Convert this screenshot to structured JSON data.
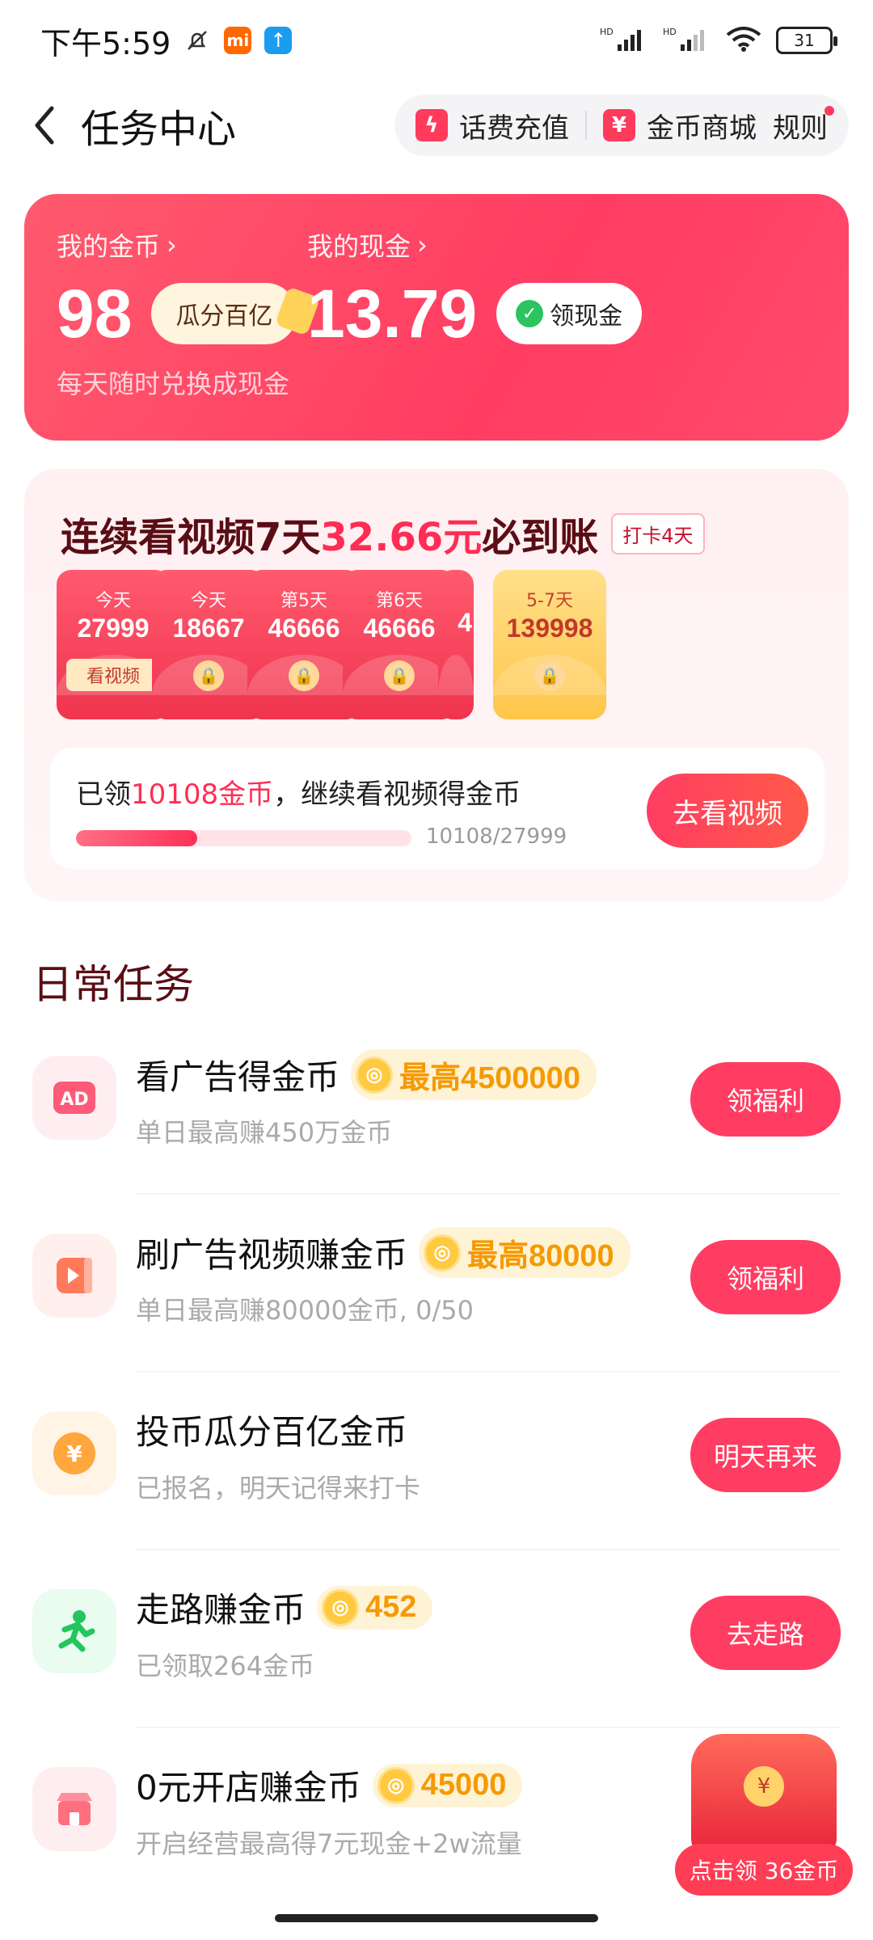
{
  "status_bar": {
    "time": "下午5:59",
    "battery": "31"
  },
  "header": {
    "title": "任务中心",
    "actions": {
      "recharge": "话费充值",
      "mall": "金币商城",
      "rules": "规则"
    }
  },
  "wallet": {
    "coins_label": "我的金币",
    "coins_value": "98",
    "share_btn": "瓜分百亿",
    "coins_sub": "每天随时兑换成现金",
    "cash_label": "我的现金",
    "cash_value": "13.79",
    "withdraw_btn": "领现金"
  },
  "streak": {
    "title_a": "连续看视频7天",
    "title_amount": "32.66元",
    "title_b": "必到账",
    "checkin_tag": "打卡4天",
    "envelopes": [
      {
        "day": "今天",
        "amount": "27999",
        "action": "看视频"
      },
      {
        "day": "今天",
        "amount": "18667"
      },
      {
        "day": "第5天",
        "amount": "46666"
      },
      {
        "day": "第6天",
        "amount": "46666"
      },
      {
        "amount": "4"
      },
      {
        "day": "5-7天",
        "amount": "139998"
      }
    ],
    "progress_prefix": "已领",
    "progress_amount": "10108金币",
    "progress_suffix": "，继续看视频得金币",
    "progress_count": "10108/27999",
    "progress_fraction": 0.361,
    "go_btn": "去看视频"
  },
  "daily": {
    "title": "日常任务",
    "tasks": [
      {
        "name": "看广告得金币",
        "reward": "最高4500000",
        "sub": "单日最高赚450万金币",
        "btn": "领福利",
        "icon": "ad-icon"
      },
      {
        "name": "刷广告视频赚金币",
        "reward": "最高80000",
        "sub": "单日最高赚80000金币, 0/50",
        "btn": "领福利",
        "icon": "video-icon"
      },
      {
        "name": "投币瓜分百亿金币",
        "sub": "已报名，明天记得来打卡",
        "btn": "明天再来",
        "icon": "yuan-coin-icon"
      },
      {
        "name": "走路赚金币",
        "reward": "452",
        "sub": "已领取264金币",
        "btn": "去走路",
        "icon": "running-person-icon"
      },
      {
        "name": "0元开店赚金币",
        "reward": "45000",
        "sub": "开启经营最高得7元现金+2w流量",
        "btn": "",
        "icon": "shop-icon"
      }
    ]
  },
  "float_reward": {
    "label": "点击领 36金币"
  },
  "colors": {
    "accent": "#ff3d62",
    "gold": "#f59a00"
  }
}
